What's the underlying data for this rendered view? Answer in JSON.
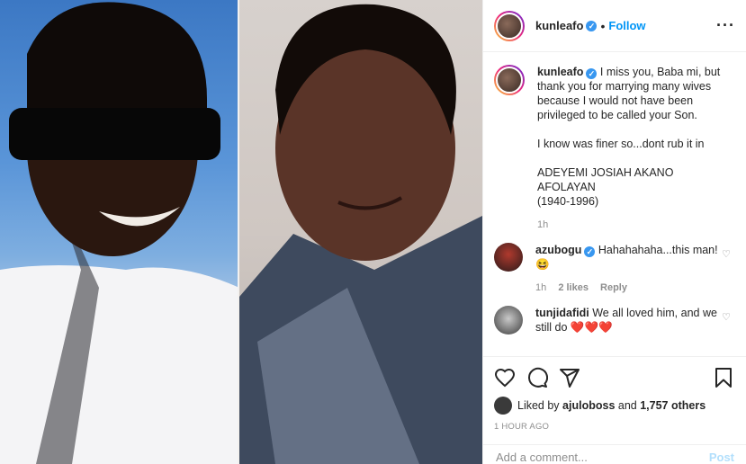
{
  "post": {
    "author": "kunleafo",
    "follow_label": "Follow",
    "more_label": "···"
  },
  "caption": {
    "username": "kunleafo",
    "p1": "I miss you, Baba mi, but thank you for marrying many wives because I would not have been privileged to be called your Son.",
    "p2": "I know was finer so...dont rub it in",
    "p3a": "ADEYEMI JOSIAH AKANO AFOLAYAN",
    "p3b": "(1940-1996)",
    "time": "1h"
  },
  "comments": [
    {
      "username": "azubogu",
      "text": "Hahahahaha...this man! 😆",
      "time": "1h",
      "likes": "2 likes",
      "reply": "Reply"
    },
    {
      "username": "tunjidafidi",
      "text": "We all loved him, and we still do",
      "hearts": "❤️❤️❤️"
    }
  ],
  "likes": {
    "prefix": "Liked by",
    "user": "ajuloboss",
    "and": "and",
    "count": "1,757 others"
  },
  "timestamp": "1 HOUR AGO",
  "add_comment": {
    "placeholder": "Add a comment...",
    "post_label": "Post"
  },
  "colors": {
    "accent": "#0095f6",
    "verified": "#3897f0",
    "muted": "#8e8e8e",
    "post_disabled": "#b2dffc"
  },
  "icons": [
    "verified-icon",
    "more-icon",
    "heart-icon",
    "comment-icon",
    "share-icon",
    "bookmark-icon"
  ]
}
